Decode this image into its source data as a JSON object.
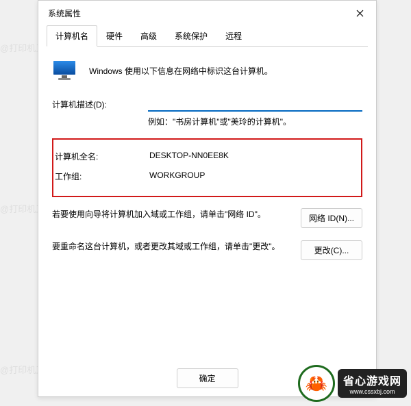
{
  "dialog": {
    "title": "系统属性",
    "tabs": {
      "computerName": "计算机名",
      "hardware": "硬件",
      "advanced": "高级",
      "systemProtection": "系统保护",
      "remote": "远程"
    },
    "intro": "Windows 使用以下信息在网络中标识这台计算机。",
    "descLabel": "计算机描述(D):",
    "descValue": "",
    "example": "例如：\"书房计算机\"或\"美玲的计算机\"。",
    "fullNameLabel": "计算机全名:",
    "fullNameValue": "DESKTOP-NN0EE8K",
    "workgroupLabel": "工作组:",
    "workgroupValue": "WORKGROUP",
    "networkIdText": "若要使用向导将计算机加入域或工作组，请单击\"网络 ID\"。",
    "networkIdButton": "网络 ID(N)...",
    "changeText": "要重命名这台计算机，或者更改其域或工作组，请单击\"更改\"。",
    "changeButton": "更改(C)...",
    "okButton": "确定"
  },
  "watermark": "@打印机卫士",
  "cornerLogo": {
    "big": "省心游戏网",
    "small": "www.cssxbj.com"
  }
}
